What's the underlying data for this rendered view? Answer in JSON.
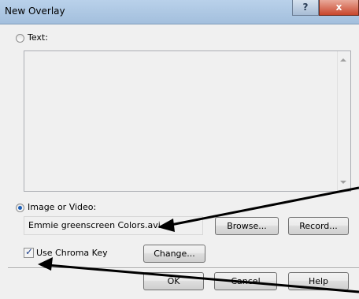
{
  "window": {
    "title": "New Overlay",
    "help_label": "?",
    "close_label": "x"
  },
  "text_option": {
    "label": "Text:",
    "selected": false,
    "value": ""
  },
  "image_option": {
    "label": "Image or Video:",
    "selected": true,
    "filename": "Emmie greenscreen Colors.avi",
    "browse_label": "Browse...",
    "record_label": "Record..."
  },
  "chroma": {
    "label": "Use Chroma Key",
    "checked": true,
    "change_label": "Change..."
  },
  "footer": {
    "ok_label": "OK",
    "cancel_label": "Cancel",
    "help_label": "Help"
  },
  "icons": {
    "help": "question-mark-icon",
    "close": "close-icon",
    "annotation": "arrow-icon"
  },
  "colors": {
    "title_bar": "#a3bfdd",
    "close_button": "#c9462c",
    "radio_dot": "#1d5fb8",
    "annotation_arrow": "#000000"
  }
}
